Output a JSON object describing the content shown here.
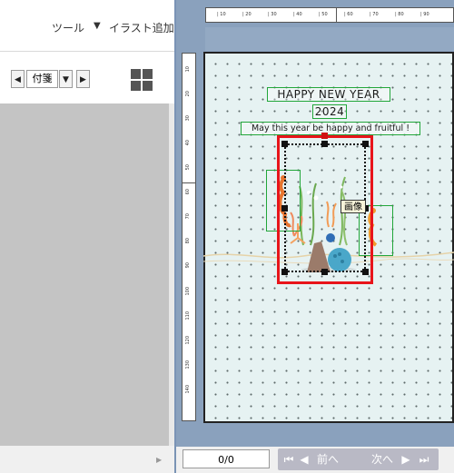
{
  "menu": {
    "tools": "ツール",
    "add_illustration": "イラスト追加"
  },
  "page_nav": {
    "selected_value": "付箋"
  },
  "hruler_ticks": [
    "10",
    "20",
    "30",
    "40",
    "50",
    "60",
    "70",
    "80",
    "90"
  ],
  "vruler_ticks": [
    "10",
    "20",
    "30",
    "40",
    "50",
    "60",
    "70",
    "80",
    "90",
    "100",
    "110",
    "120",
    "130",
    "140"
  ],
  "card": {
    "title": "HAPPY NEW YEAR",
    "year": "2024",
    "message": "May this year be happy and fruitful !"
  },
  "tooltip": "画像",
  "bottom": {
    "page_counter": "0/0",
    "prev_label": "前へ",
    "next_label": "次へ"
  },
  "colors": {
    "selection": "#e8141a",
    "guide": "#22a63a",
    "canvas": "#8aa1bd",
    "paper": "#e6f2f2"
  }
}
